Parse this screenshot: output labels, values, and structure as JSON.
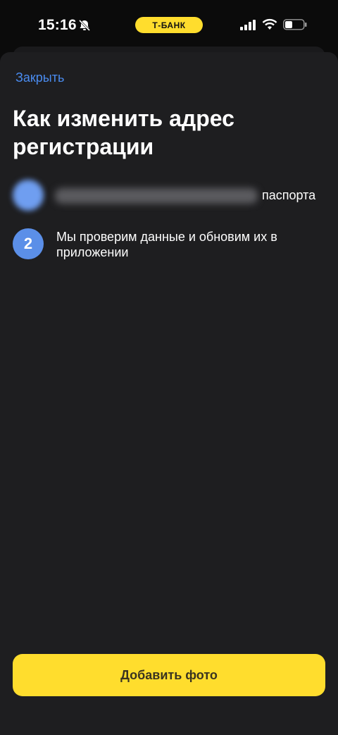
{
  "status_bar": {
    "time": "15:16",
    "brand": "Т-БАНК",
    "icons": [
      "bell-muted-icon",
      "signal-icon",
      "wifi-icon",
      "battery-icon"
    ]
  },
  "sheet": {
    "close_label": "Закрыть",
    "title": "Как изменить адрес регистрации",
    "steps": [
      {
        "number": "1",
        "text": "паспорта",
        "partially_hidden": true
      },
      {
        "number": "2",
        "text": "Мы проверим данные и обновим их в приложении"
      }
    ],
    "primary_button": "Добавить фото"
  },
  "colors": {
    "accent_yellow": "#ffdd2d",
    "link_blue": "#4a8cf0",
    "step_blue": "#5b8fe8",
    "sheet_bg": "#1e1e20"
  }
}
